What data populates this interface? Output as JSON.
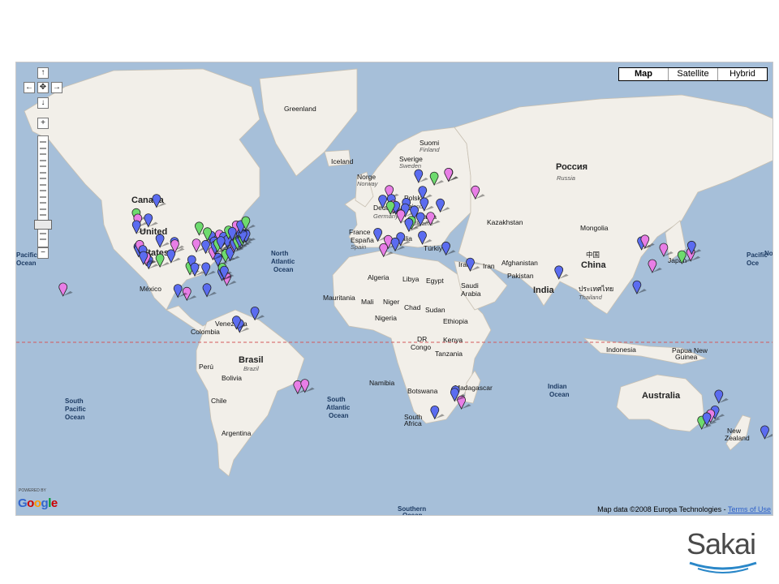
{
  "map": {
    "type_buttons": [
      "Map",
      "Satellite",
      "Hybrid"
    ],
    "nav": {
      "up": "↑",
      "left": "←",
      "center": "✥",
      "right": "→",
      "down": "↓",
      "zoom_in": "+",
      "zoom_out": "−"
    },
    "powered_by": "POWERED BY",
    "google_logo": [
      "G",
      "o",
      "o",
      "g",
      "l",
      "e"
    ],
    "google_colors": [
      "#3366cc",
      "#cc0000",
      "#ff9900",
      "#3366cc",
      "#009933",
      "#cc0000"
    ],
    "copyright": "Map data ©2008 Europa Technologies - ",
    "terms_link": "Terms of Use",
    "labels": [
      {
        "text": "Greenland",
        "cls": "country"
      },
      {
        "text": "Iceland",
        "cls": "country"
      },
      {
        "text": "Canada",
        "cls": "cont"
      },
      {
        "text": "United",
        "cls": "cont"
      },
      {
        "text": "States",
        "cls": "cont"
      },
      {
        "text": "México",
        "cls": "country"
      },
      {
        "text": "North",
        "cls": "ocean"
      },
      {
        "text": "Atlantic",
        "cls": "ocean"
      },
      {
        "text": "Ocean",
        "cls": "ocean"
      },
      {
        "text": "Pacific",
        "cls": "ocean"
      },
      {
        "text": "Ocean",
        "cls": "ocean"
      },
      {
        "text": "South",
        "cls": "ocean"
      },
      {
        "text": "Pacific",
        "cls": "ocean"
      },
      {
        "text": "Ocean",
        "cls": "ocean"
      },
      {
        "text": "South",
        "cls": "ocean"
      },
      {
        "text": "Atlantic",
        "cls": "ocean"
      },
      {
        "text": "Ocean",
        "cls": "ocean"
      },
      {
        "text": "Venezuela",
        "cls": "country"
      },
      {
        "text": "Colombia",
        "cls": "country"
      },
      {
        "text": "Brasil",
        "cls": "cont"
      },
      {
        "text": "Brazil",
        "cls": "sub"
      },
      {
        "text": "Perú",
        "cls": "country"
      },
      {
        "text": "Bolivia",
        "cls": "country"
      },
      {
        "text": "Chile",
        "cls": "country"
      },
      {
        "text": "Argentina",
        "cls": "country"
      },
      {
        "text": "Suomi",
        "cls": "country"
      },
      {
        "text": "Finland",
        "cls": "sub"
      },
      {
        "text": "Sverige",
        "cls": "country"
      },
      {
        "text": "Sweden",
        "cls": "sub"
      },
      {
        "text": "Norge",
        "cls": "country"
      },
      {
        "text": "Norway",
        "cls": "sub"
      },
      {
        "text": "Polska",
        "cls": "country"
      },
      {
        "text": "Poland",
        "cls": "sub"
      },
      {
        "text": "Deutschland",
        "cls": "country"
      },
      {
        "text": "Germany",
        "cls": "sub"
      },
      {
        "text": "France",
        "cls": "country"
      },
      {
        "text": "España",
        "cls": "country"
      },
      {
        "text": "Spain",
        "cls": "sub"
      },
      {
        "text": "Italia",
        "cls": "country"
      },
      {
        "text": "Україна",
        "cls": "country"
      },
      {
        "text": "Ukraine",
        "cls": "sub"
      },
      {
        "text": "Türkiye",
        "cls": "country"
      },
      {
        "text": "Россия",
        "cls": "cont"
      },
      {
        "text": "Russia",
        "cls": "sub"
      },
      {
        "text": "Kazakhstan",
        "cls": "country"
      },
      {
        "text": "Mongolia",
        "cls": "country"
      },
      {
        "text": "中国",
        "cls": "country"
      },
      {
        "text": "China",
        "cls": "cont"
      },
      {
        "text": "Japan",
        "cls": "country"
      },
      {
        "text": "Iraq",
        "cls": "country"
      },
      {
        "text": "Iran",
        "cls": "country"
      },
      {
        "text": "Afghanistan",
        "cls": "country"
      },
      {
        "text": "Pakistan",
        "cls": "country"
      },
      {
        "text": "India",
        "cls": "cont"
      },
      {
        "text": "Saudi",
        "cls": "country"
      },
      {
        "text": "Arabia",
        "cls": "country"
      },
      {
        "text": "Egypt",
        "cls": "country"
      },
      {
        "text": "Libya",
        "cls": "country"
      },
      {
        "text": "Algeria",
        "cls": "country"
      },
      {
        "text": "Mauritania",
        "cls": "country"
      },
      {
        "text": "Mali",
        "cls": "country"
      },
      {
        "text": "Niger",
        "cls": "country"
      },
      {
        "text": "Chad",
        "cls": "country"
      },
      {
        "text": "Sudan",
        "cls": "country"
      },
      {
        "text": "Nigeria",
        "cls": "country"
      },
      {
        "text": "Ethiopia",
        "cls": "country"
      },
      {
        "text": "DR",
        "cls": "country"
      },
      {
        "text": "Congo",
        "cls": "country"
      },
      {
        "text": "Kenya",
        "cls": "country"
      },
      {
        "text": "Tanzania",
        "cls": "country"
      },
      {
        "text": "Namibia",
        "cls": "country"
      },
      {
        "text": "Botswana",
        "cls": "country"
      },
      {
        "text": "South",
        "cls": "country"
      },
      {
        "text": "Africa",
        "cls": "country"
      },
      {
        "text": "Madagascar",
        "cls": "country"
      },
      {
        "text": "Indian",
        "cls": "ocean"
      },
      {
        "text": "Ocean",
        "cls": "ocean"
      },
      {
        "text": "ประเทศไทย",
        "cls": "country"
      },
      {
        "text": "Thailand",
        "cls": "sub"
      },
      {
        "text": "Indonesia",
        "cls": "country"
      },
      {
        "text": "Papua New",
        "cls": "country"
      },
      {
        "text": "Guinea",
        "cls": "country"
      },
      {
        "text": "Australia",
        "cls": "cont"
      },
      {
        "text": "New",
        "cls": "country"
      },
      {
        "text": "Zealand",
        "cls": "country"
      },
      {
        "text": "Southern",
        "cls": "ocean"
      },
      {
        "text": "Ocean",
        "cls": "ocean"
      },
      {
        "text": "Pacific",
        "cls": "ocean"
      },
      {
        "text": "Oce",
        "cls": "ocean"
      },
      {
        "text": "No",
        "cls": "ocean"
      }
    ]
  },
  "markers": {
    "colors": {
      "blue": "#5b6cf0",
      "pink": "#e87ee6",
      "green": "#6edb6e"
    },
    "list": [
      {
        "c": "green",
        "x": -123.1,
        "y": 49.3
      },
      {
        "c": "pink",
        "x": -122.4,
        "y": 47.6
      },
      {
        "c": "blue",
        "x": -123.0,
        "y": 45.5
      },
      {
        "c": "blue",
        "x": -117.4,
        "y": 47.7
      },
      {
        "c": "blue",
        "x": -122.3,
        "y": 37.8
      },
      {
        "c": "blue",
        "x": -122.0,
        "y": 37.3
      },
      {
        "c": "pink",
        "x": -121.5,
        "y": 38.6
      },
      {
        "c": "blue",
        "x": -120.0,
        "y": 36.7
      },
      {
        "c": "green",
        "x": -118.2,
        "y": 34.1
      },
      {
        "c": "blue",
        "x": -117.2,
        "y": 32.7
      },
      {
        "c": "pink",
        "x": -118.4,
        "y": 34.0
      },
      {
        "c": "blue",
        "x": -119.7,
        "y": 34.4
      },
      {
        "c": "green",
        "x": -111.9,
        "y": 33.4
      },
      {
        "c": "blue",
        "x": -111.9,
        "y": 40.8
      },
      {
        "c": "blue",
        "x": -106.6,
        "y": 35.1
      },
      {
        "c": "blue",
        "x": -105.0,
        "y": 39.7
      },
      {
        "c": "pink",
        "x": -104.8,
        "y": 38.8
      },
      {
        "c": "green",
        "x": -97.7,
        "y": 30.3
      },
      {
        "c": "blue",
        "x": -96.8,
        "y": 32.8
      },
      {
        "c": "blue",
        "x": -95.4,
        "y": 29.8
      },
      {
        "c": "pink",
        "x": -94.6,
        "y": 39.1
      },
      {
        "c": "green",
        "x": -93.3,
        "y": 45.0
      },
      {
        "c": "blue",
        "x": -90.2,
        "y": 38.6
      },
      {
        "c": "blue",
        "x": -87.6,
        "y": 41.9
      },
      {
        "c": "green",
        "x": -89.4,
        "y": 43.1
      },
      {
        "c": "blue",
        "x": -86.2,
        "y": 39.8
      },
      {
        "c": "pink",
        "x": -83.7,
        "y": 42.3
      },
      {
        "c": "blue",
        "x": -84.4,
        "y": 33.7
      },
      {
        "c": "blue",
        "x": -81.7,
        "y": 41.5
      },
      {
        "c": "green",
        "x": -80.8,
        "y": 35.2
      },
      {
        "c": "blue",
        "x": -79.9,
        "y": 40.4
      },
      {
        "c": "blue",
        "x": -78.6,
        "y": 35.8
      },
      {
        "c": "pink",
        "x": -77.0,
        "y": 38.9
      },
      {
        "c": "blue",
        "x": -76.6,
        "y": 39.3
      },
      {
        "c": "green",
        "x": -75.2,
        "y": 40.0
      },
      {
        "c": "blue",
        "x": -74.0,
        "y": 40.7
      },
      {
        "c": "blue",
        "x": -73.8,
        "y": 42.7
      },
      {
        "c": "green",
        "x": -72.9,
        "y": 41.3
      },
      {
        "c": "blue",
        "x": -71.1,
        "y": 42.4
      },
      {
        "c": "blue",
        "x": -72.6,
        "y": 42.4
      },
      {
        "c": "green",
        "x": -79.4,
        "y": 43.7
      },
      {
        "c": "pink",
        "x": -75.7,
        "y": 45.4
      },
      {
        "c": "blue",
        "x": -73.6,
        "y": 45.5
      },
      {
        "c": "green",
        "x": -71.2,
        "y": 46.8
      },
      {
        "c": "pink",
        "x": -80.2,
        "y": 25.8
      },
      {
        "c": "blue",
        "x": -82.5,
        "y": 27.9
      },
      {
        "c": "green",
        "x": -82.3,
        "y": 29.7
      },
      {
        "c": "blue",
        "x": -81.4,
        "y": 28.5
      },
      {
        "c": "blue",
        "x": -90.1,
        "y": 29.9
      },
      {
        "c": "pink",
        "x": -86.8,
        "y": 36.2
      },
      {
        "c": "blue",
        "x": -85.8,
        "y": 38.3
      },
      {
        "c": "green",
        "x": -84.5,
        "y": 39.1
      },
      {
        "c": "blue",
        "x": -83.0,
        "y": 40.0
      },
      {
        "c": "blue",
        "x": -77.6,
        "y": 43.2
      },
      {
        "c": "blue",
        "x": -113.5,
        "y": 53.5
      },
      {
        "c": "pink",
        "x": -99.1,
        "y": 19.4
      },
      {
        "c": "blue",
        "x": -103.4,
        "y": 20.7
      },
      {
        "c": "blue",
        "x": -89.6,
        "y": 21.0
      },
      {
        "c": "pink",
        "x": -157.8,
        "y": 21.3
      },
      {
        "c": "blue",
        "x": -66.9,
        "y": 10.5
      },
      {
        "c": "blue",
        "x": -74.1,
        "y": 4.7
      },
      {
        "c": "blue",
        "x": -75.6,
        "y": 6.2
      },
      {
        "c": "pink",
        "x": -46.6,
        "y": -23.5
      },
      {
        "c": "pink",
        "x": -43.2,
        "y": -22.9
      },
      {
        "c": "pink",
        "x": 25.0,
        "y": 60.2
      },
      {
        "c": "pink",
        "x": 24.9,
        "y": 60.2
      },
      {
        "c": "green",
        "x": 18.1,
        "y": 59.3
      },
      {
        "c": "blue",
        "x": 10.7,
        "y": 59.9
      },
      {
        "c": "blue",
        "x": 12.6,
        "y": 55.7
      },
      {
        "c": "pink",
        "x": -3.2,
        "y": 55.9
      },
      {
        "c": "blue",
        "x": -6.3,
        "y": 53.3
      },
      {
        "c": "blue",
        "x": -2.2,
        "y": 53.5
      },
      {
        "c": "pink",
        "x": -1.3,
        "y": 51.8
      },
      {
        "c": "blue",
        "x": -0.1,
        "y": 51.5
      },
      {
        "c": "green",
        "x": -2.6,
        "y": 51.5
      },
      {
        "c": "blue",
        "x": 4.9,
        "y": 52.4
      },
      {
        "c": "blue",
        "x": 4.4,
        "y": 50.8
      },
      {
        "c": "pink",
        "x": 2.3,
        "y": 48.9
      },
      {
        "c": "blue",
        "x": 8.7,
        "y": 50.1
      },
      {
        "c": "blue",
        "x": 13.4,
        "y": 52.5
      },
      {
        "c": "blue",
        "x": 11.6,
        "y": 48.1
      },
      {
        "c": "green",
        "x": 7.4,
        "y": 46.9
      },
      {
        "c": "blue",
        "x": 21.0,
        "y": 52.2
      },
      {
        "c": "pink",
        "x": 16.4,
        "y": 48.2
      },
      {
        "c": "blue",
        "x": 6.1,
        "y": 46.2
      },
      {
        "c": "blue",
        "x": -8.6,
        "y": 42.9
      },
      {
        "c": "pink",
        "x": -3.7,
        "y": 40.4
      },
      {
        "c": "blue",
        "x": 2.2,
        "y": 41.4
      },
      {
        "c": "blue",
        "x": -0.4,
        "y": 39.5
      },
      {
        "c": "pink",
        "x": -5.9,
        "y": 37.4
      },
      {
        "c": "blue",
        "x": 12.5,
        "y": 41.9
      },
      {
        "c": "blue",
        "x": 23.7,
        "y": 38.0
      },
      {
        "c": "blue",
        "x": 35.2,
        "y": 31.8
      },
      {
        "c": "pink",
        "x": 37.6,
        "y": 55.8
      },
      {
        "c": "blue",
        "x": 77.2,
        "y": 28.6
      },
      {
        "c": "blue",
        "x": 116.4,
        "y": 39.9
      },
      {
        "c": "pink",
        "x": 121.5,
        "y": 31.2
      },
      {
        "c": "blue",
        "x": 114.2,
        "y": 22.3
      },
      {
        "c": "pink",
        "x": 126.9,
        "y": 37.5
      },
      {
        "c": "green",
        "x": 135.5,
        "y": 34.7
      },
      {
        "c": "pink",
        "x": 139.7,
        "y": 35.7
      },
      {
        "c": "blue",
        "x": 140.1,
        "y": 38.3
      },
      {
        "c": "pink",
        "x": 118.0,
        "y": 40.5
      },
      {
        "c": "blue",
        "x": 28.0,
        "y": -26.2
      },
      {
        "c": "blue",
        "x": 28.2,
        "y": -25.7
      },
      {
        "c": "pink",
        "x": 31.0,
        "y": -29.9
      },
      {
        "c": "blue",
        "x": 18.4,
        "y": -33.9
      },
      {
        "c": "blue",
        "x": 27.8,
        "y": -26.7
      },
      {
        "c": "blue",
        "x": 151.2,
        "y": -33.9
      },
      {
        "c": "pink",
        "x": 149.1,
        "y": -35.3
      },
      {
        "c": "green",
        "x": 144.9,
        "y": -37.8
      },
      {
        "c": "blue",
        "x": 153.0,
        "y": -27.5
      },
      {
        "c": "blue",
        "x": 174.8,
        "y": -41.3
      },
      {
        "c": "blue",
        "x": 147.3,
        "y": -36.5
      }
    ]
  },
  "brand": {
    "name": "Sakai"
  }
}
